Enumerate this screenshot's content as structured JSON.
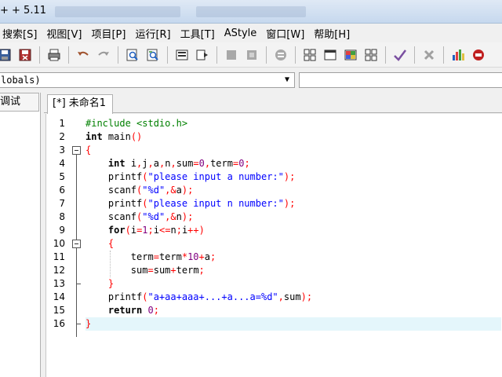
{
  "window": {
    "title": "+ + 5.11"
  },
  "menu": {
    "items": [
      "搜索[S]",
      "视图[V]",
      "项目[P]",
      "运行[R]",
      "工具[T]",
      "AStyle",
      "窗口[W]",
      "帮助[H]"
    ]
  },
  "scope": {
    "value": "lobals)"
  },
  "left_panel": {
    "tab_label": "调试"
  },
  "editor": {
    "tab_label": "[*] 未命名1",
    "line_numbers": [
      "1",
      "2",
      "3",
      "4",
      "5",
      "6",
      "7",
      "8",
      "9",
      "10",
      "11",
      "12",
      "13",
      "14",
      "15",
      "16"
    ],
    "current_line": 16,
    "code_lines": [
      "#include <stdio.h>",
      "int main()",
      "{",
      "    int i,j,a,n,sum=0,term=0;",
      "    printf(\"please input a number:\");",
      "    scanf(\"%d\",&a);",
      "    printf(\"please input n number:\");",
      "    scanf(\"%d\",&n);",
      "    for(i=1;i<=n;i++)",
      "    {",
      "        term=term*10+a;",
      "        sum=sum+term;",
      "    }",
      "    printf(\"a+aa+aaa+...+a...a=%d\",sum);",
      "    return 0;",
      "}"
    ]
  },
  "toolbar": {
    "icons": [
      "save-all-icon",
      "close-file-icon",
      "print-icon",
      "undo-icon",
      "redo-icon",
      "find-icon",
      "replace-icon",
      "compile-icon",
      "run-icon",
      "stop-icon",
      "debug-icon",
      "format-icon",
      "layout-icon",
      "window-icon",
      "color-icon",
      "grid-icon",
      "check-icon",
      "delete-icon",
      "chart-icon",
      "profile-icon"
    ]
  },
  "colors": {
    "keyword": "#000000",
    "preprocessor": "#008000",
    "string": "#0000ff",
    "number": "#800080",
    "operator": "#ff0000",
    "current_line_bg": "#e4f6fb"
  }
}
